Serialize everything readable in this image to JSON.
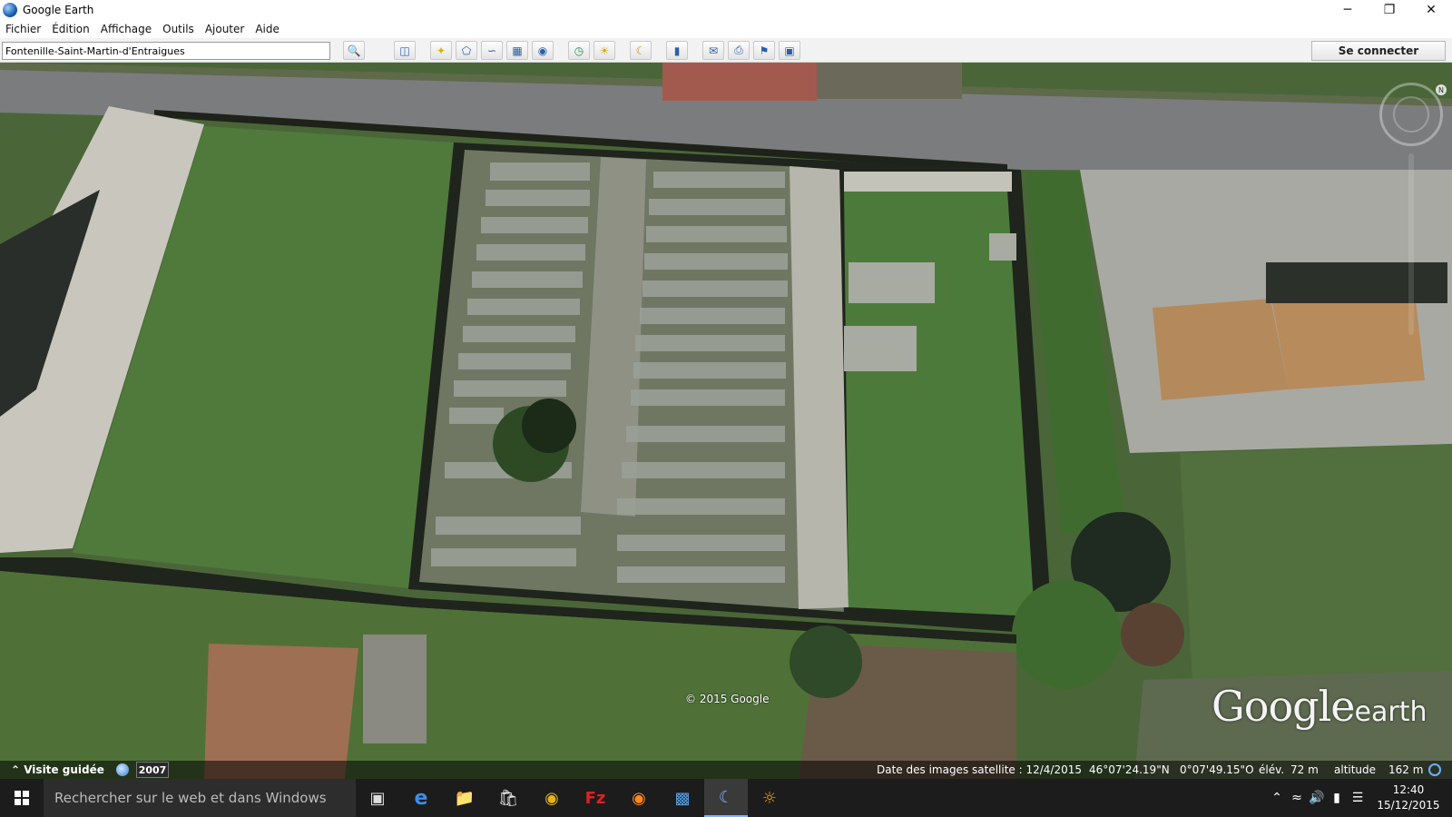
{
  "window": {
    "title": "Google Earth",
    "controls": {
      "minimize": "─",
      "restore": "❐",
      "close": "✕"
    }
  },
  "menu": {
    "items": [
      "Fichier",
      "Édition",
      "Affichage",
      "Outils",
      "Ajouter",
      "Aide"
    ]
  },
  "toolbar": {
    "search_value": "Fontenille-Saint-Martin-d'Entraigues",
    "connect_label": "Se connecter",
    "buttons": [
      {
        "name": "search-button",
        "icon": "magnifier"
      },
      {
        "name": "sidebar-toggle-button",
        "icon": "sidebar"
      },
      {
        "name": "add-placemark-button",
        "icon": "pushpin"
      },
      {
        "name": "add-polygon-button",
        "icon": "polygon"
      },
      {
        "name": "add-path-button",
        "icon": "path"
      },
      {
        "name": "add-overlay-button",
        "icon": "overlay"
      },
      {
        "name": "record-tour-button",
        "icon": "camera"
      },
      {
        "name": "historical-imagery-button",
        "icon": "clock"
      },
      {
        "name": "sunlight-button",
        "icon": "sun"
      },
      {
        "name": "planet-switch-button",
        "icon": "planet"
      },
      {
        "name": "ruler-button",
        "icon": "ruler"
      },
      {
        "name": "email-button",
        "icon": "envelope"
      },
      {
        "name": "print-button",
        "icon": "printer"
      },
      {
        "name": "view-in-maps-button",
        "icon": "maps"
      },
      {
        "name": "save-image-button",
        "icon": "image"
      }
    ]
  },
  "map": {
    "copyright": "© 2015 Google",
    "brand_main": "Google",
    "brand_sub": "earth"
  },
  "status": {
    "tour_label": "Visite guidée",
    "year": "2007",
    "imagery_date": "Date des images satellite : 12/4/2015",
    "latitude": "46°07'24.19\"N",
    "longitude": "0°07'49.15\"O",
    "elevation_label": "élév.",
    "elevation_value": "72 m",
    "altitude_label": "altitude",
    "altitude_value": "162 m"
  },
  "taskbar": {
    "search_placeholder": "Rechercher sur le web et dans Windows",
    "clock_time": "12:40",
    "clock_date": "15/12/2015"
  },
  "colors": {
    "grass": "#4f6b3c",
    "road": "#7d7d7f",
    "gravel": "#b8b7b0",
    "roof": "#b8825b",
    "wall": "#1e2219"
  }
}
